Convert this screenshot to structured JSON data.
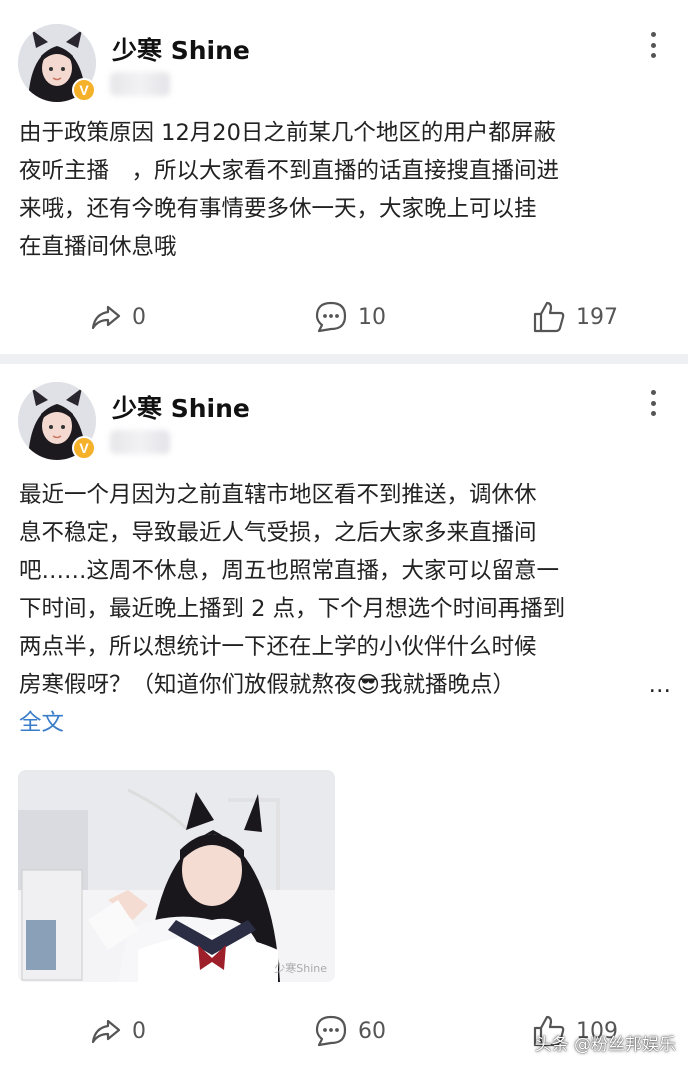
{
  "posts": [
    {
      "author": "少寒 Shine",
      "verified_badge": "V",
      "text_lines": [
        "由于政策原因 12月20日之前某几个地区的用户都屏蔽",
        "夜听主播　，所以大家看不到直播的话直接搜直播间进",
        "来哦，还有今晚有事情要多休一天，大家晚上可以挂",
        "在直播间休息哦"
      ],
      "actions": {
        "share": "0",
        "comment": "10",
        "like": "197"
      }
    },
    {
      "author": "少寒 Shine",
      "verified_badge": "V",
      "text_lines": [
        "最近一个月因为之前直辖市地区看不到推送，调休休",
        "息不稳定，导致最近人气受损，之后大家多来直播间",
        "吧……这周不休息，周五也照常直播，大家可以留意一",
        "下时间，最近晚上播到 2 点，下个月想选个时间再播到",
        "两点半，所以想统计一下还在上学的小伙伴什么时候",
        "房寒假呀？（知道你们放假就熬夜😎我就播晚点）"
      ],
      "ellipsis": "…",
      "full_text_link": "全文",
      "image_watermark": "少寒Shine",
      "actions": {
        "share": "0",
        "comment": "60",
        "like": "109"
      }
    }
  ],
  "watermark": "头条 @粉丝邦娱乐",
  "icons": {
    "share": "share-icon",
    "comment": "comment-icon",
    "like": "thumbs-up-icon",
    "more": "more-vertical-icon"
  },
  "colors": {
    "link": "#3a7dc9",
    "badge": "#f5b12a",
    "divider": "#eef0f4"
  }
}
